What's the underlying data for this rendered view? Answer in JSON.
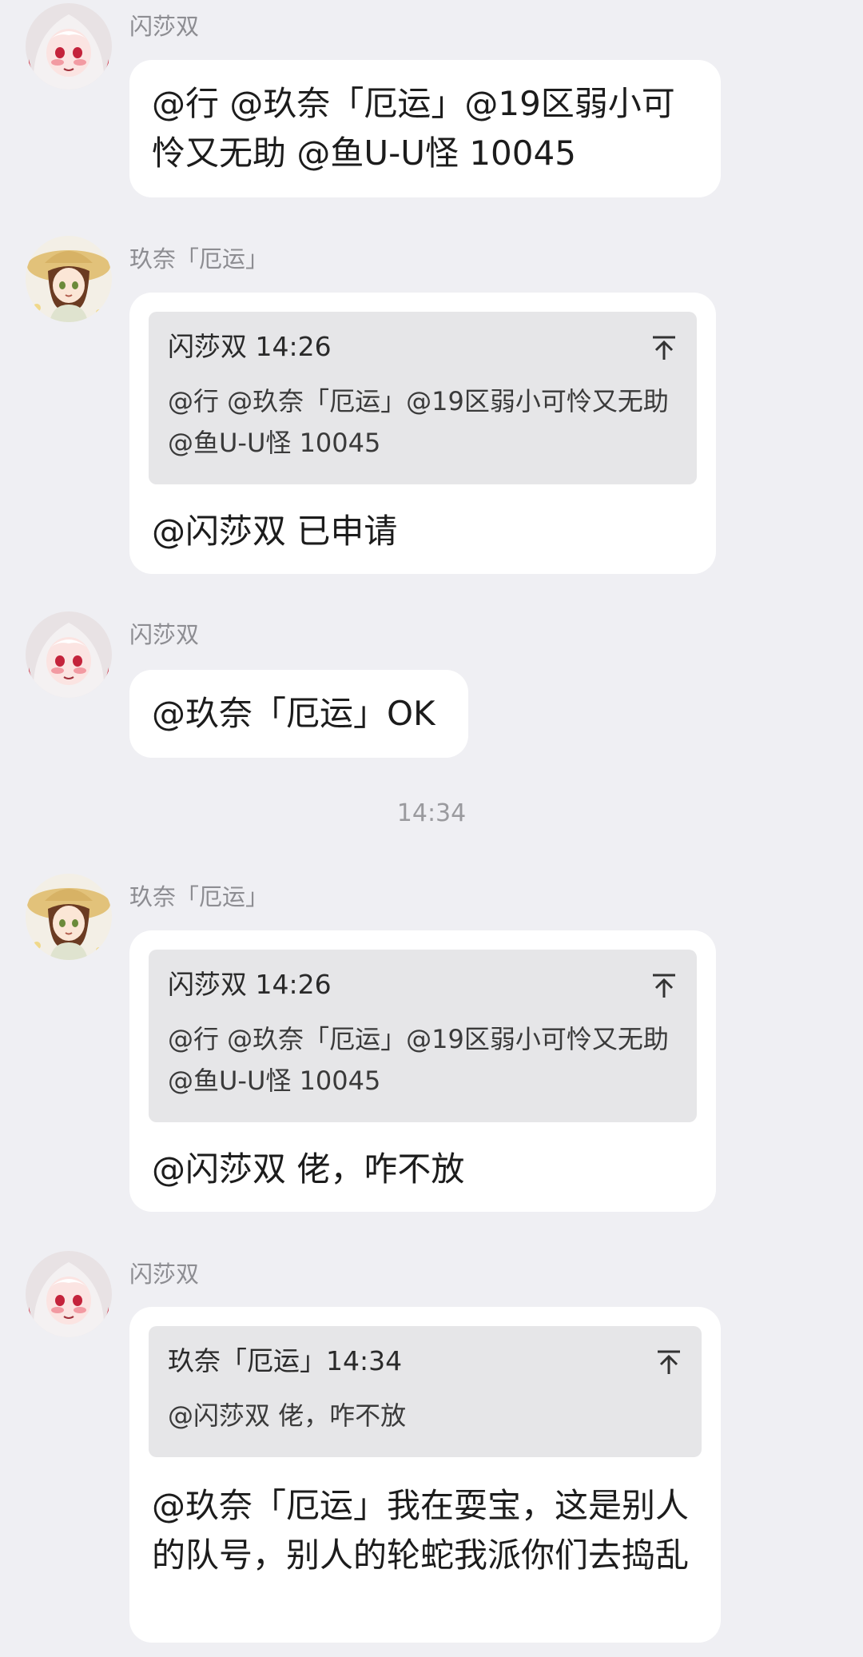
{
  "messages": [
    {
      "sender": "闪莎双",
      "text": "@行 @玖奈「厄运」@19区弱小可怜又无助 @鱼ᑌ-ᑌ怪 10045"
    },
    {
      "sender": "玖奈「厄运」",
      "quote": {
        "header": "闪莎双 14:26",
        "body": "@行 @玖奈「厄运」@19区弱小可怜又无助 @鱼ᑌ-ᑌ怪 10045"
      },
      "text": "@闪莎双 已申请"
    },
    {
      "sender": "闪莎双",
      "text": "@玖奈「厄运」OK"
    },
    {
      "sender": "玖奈「厄运」",
      "quote": {
        "header": "闪莎双 14:26",
        "body": "@行 @玖奈「厄运」@19区弱小可怜又无助 @鱼ᑌ-ᑌ怪 10045"
      },
      "text": "@闪莎双 佬，咋不放"
    },
    {
      "sender": "闪莎双",
      "quote": {
        "header": "玖奈「厄运」14:34",
        "body": "@闪莎双 佬，咋不放"
      },
      "text": "@玖奈「厄运」我在耍宝，这是别人的队号，别人的轮蛇我派你们去捣乱"
    }
  ],
  "time_separator": "14:34",
  "icons": {
    "avatar_a": "anime-girl-white-red-hair-avatar",
    "avatar_b": "anime-girl-straw-hat-avatar",
    "quote_jump": "arrow-up-to-top-icon"
  },
  "colors": {
    "background": "#efeff3",
    "bubble": "#ffffff",
    "quote_bg": "#e6e6e8",
    "sender_text": "#8d8d92"
  }
}
